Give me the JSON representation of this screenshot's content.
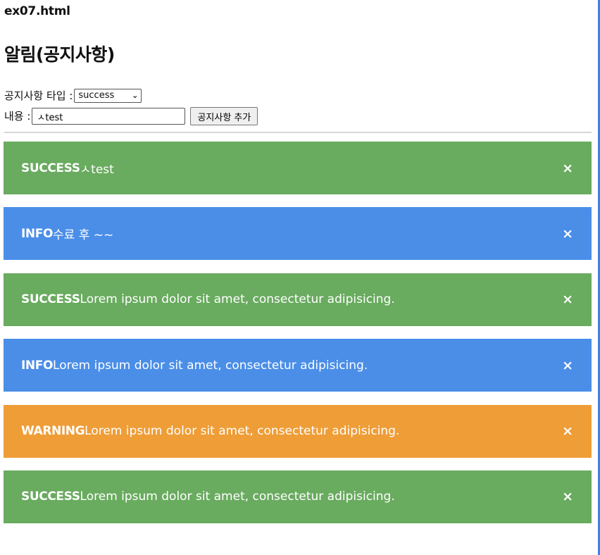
{
  "file_title": "ex07.html",
  "page_title": "알림(공지사항)",
  "form": {
    "type_label": "공지사항 타입 :",
    "type_selected": "success",
    "content_label": "내용 :",
    "content_value": "ㅅtest",
    "add_button_label": "공지사항 추가"
  },
  "colors": {
    "success": "#69ab5f",
    "info": "#4a8ee8",
    "warning": "#ef9d37"
  },
  "notices": [
    {
      "kind": "SUCCESS",
      "type": "success",
      "message": "ㅅtest",
      "close": "×"
    },
    {
      "kind": "INFO",
      "type": "info",
      "message": "수료 후 ~~",
      "close": "×"
    },
    {
      "kind": "SUCCESS",
      "type": "success",
      "message": "Lorem ipsum dolor sit amet, consectetur adipisicing.",
      "close": "×"
    },
    {
      "kind": "INFO",
      "type": "info",
      "message": "Lorem ipsum dolor sit amet, consectetur adipisicing.",
      "close": "×"
    },
    {
      "kind": "WARNING",
      "type": "warning",
      "message": "Lorem ipsum dolor sit amet, consectetur adipisicing.",
      "close": "×"
    },
    {
      "kind": "SUCCESS",
      "type": "success",
      "message": "Lorem ipsum dolor sit amet, consectetur adipisicing.",
      "close": "×"
    }
  ]
}
